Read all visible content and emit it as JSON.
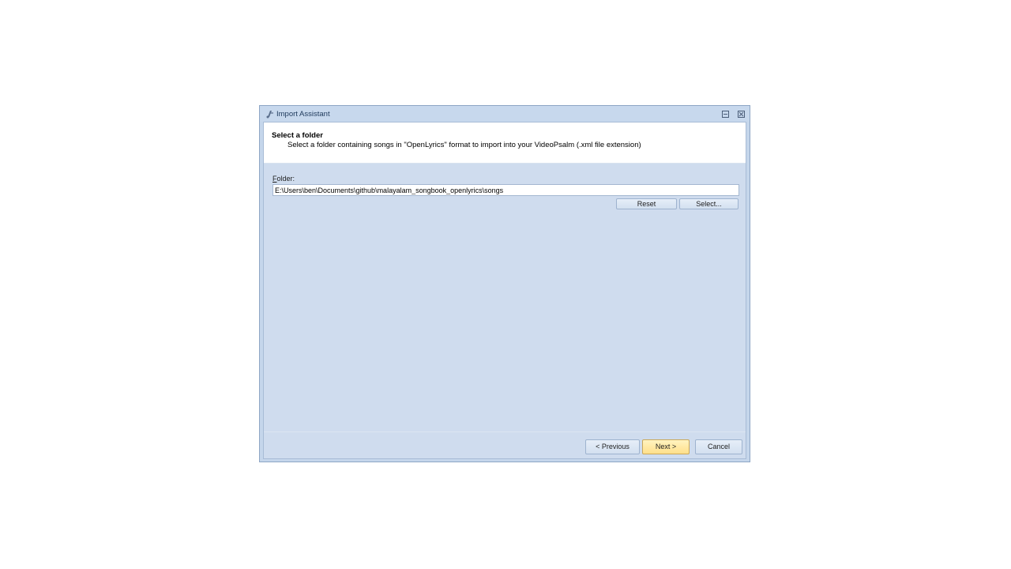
{
  "window": {
    "title": "Import Assistant"
  },
  "header": {
    "title": "Select a folder",
    "description": "Select a folder containing songs in \"OpenLyrics\" format to import into your VideoPsalm (.xml file extension)"
  },
  "form": {
    "folder_label": "Folder:",
    "folder_value": "E:\\Users\\ben\\Documents\\github\\malayalam_songbook_openlyrics\\songs",
    "reset_label": "Reset",
    "select_label": "Select..."
  },
  "footer": {
    "previous_label": "< Previous",
    "next_label": "Next >",
    "cancel_label": "Cancel"
  },
  "colors": {
    "window_bg": "#c5d6eb",
    "client_bg": "#cfdcee",
    "default_button": "#ffe08a"
  }
}
